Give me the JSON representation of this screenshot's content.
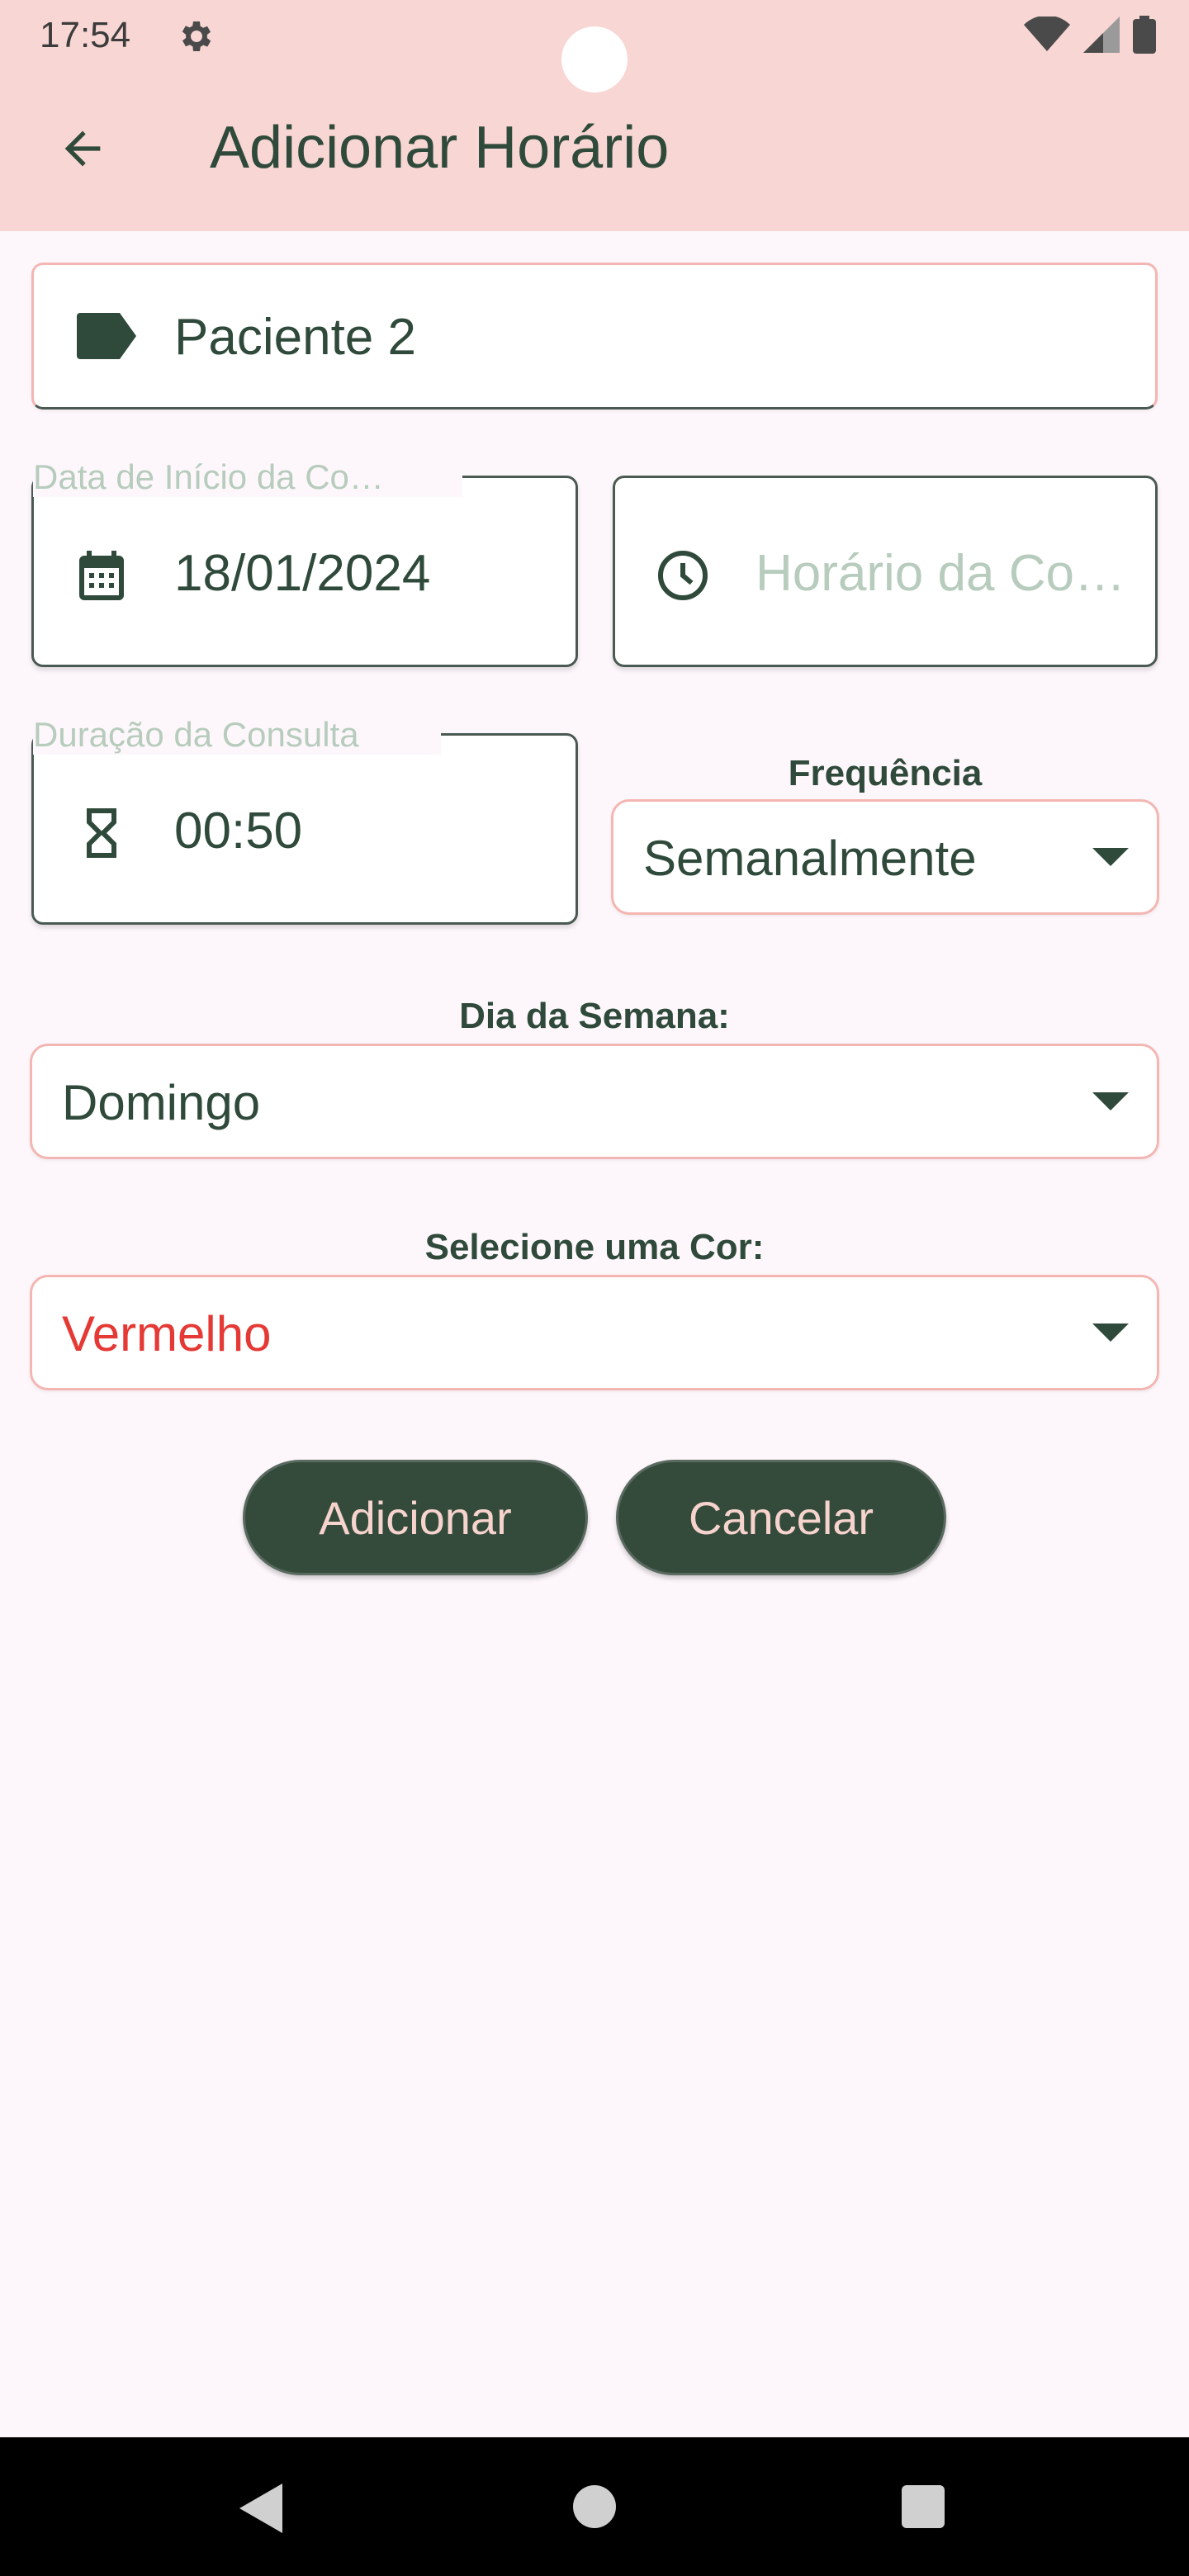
{
  "status_bar": {
    "time": "17:54",
    "icons": [
      "gear-icon",
      "wifi-icon",
      "cell-signal-icon",
      "battery-icon"
    ]
  },
  "app_bar": {
    "title": "Adicionar Horário",
    "back_icon": "arrow-back-icon"
  },
  "form": {
    "name_field": {
      "icon": "label-tag-icon",
      "value": "Paciente 2"
    },
    "date_field": {
      "label": "Data de Início da Co…",
      "icon": "calendar-icon",
      "value": "18/01/2024"
    },
    "time_field": {
      "icon": "clock-icon",
      "placeholder": "Horário da Con…"
    },
    "duration_field": {
      "label": "Duração da Consulta",
      "icon": "hourglass-icon",
      "value": "00:50"
    },
    "frequency": {
      "label": "Frequência",
      "selected": "Semanalmente"
    },
    "weekday": {
      "label": "Dia da Semana:",
      "selected": "Domingo"
    },
    "color": {
      "label": "Selecione uma Cor:",
      "selected": "Vermelho",
      "selected_color": "#e53935"
    }
  },
  "buttons": {
    "add": "Adicionar",
    "cancel": "Cancelar"
  },
  "nav_bar": {
    "icons": [
      "nav-back-icon",
      "nav-home-icon",
      "nav-recents-icon"
    ]
  },
  "colors": {
    "app_bar_bg": "#f8d6d3",
    "accent_dark_green": "#344b3c",
    "field_border_pink": "#f4b6b2",
    "hint_green": "#b7ccbd"
  }
}
